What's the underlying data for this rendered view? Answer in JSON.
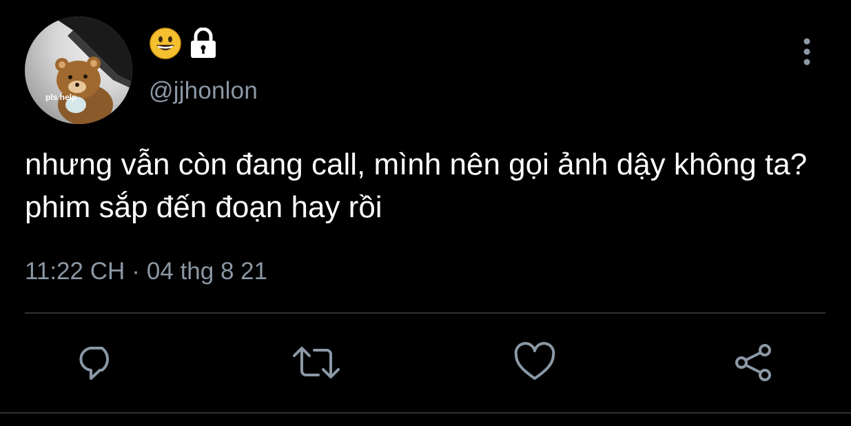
{
  "user": {
    "display_name_icons": [
      "grinning-face-emoji",
      "lock-icon"
    ],
    "handle": "@jjhonlon",
    "avatar_caption": "pls help"
  },
  "tweet": {
    "text": "nhưng vẫn còn đang call, mình nên gọi ảnh dậy không ta? phim sắp đến đoạn hay rồi",
    "time": "11:22 CH",
    "separator": "·",
    "date": "04 thg 8 21"
  },
  "actions": [
    "reply-icon",
    "retweet-icon",
    "like-icon",
    "share-icon"
  ],
  "colors": {
    "background": "#000000",
    "text": "#ffffff",
    "secondary": "#8b98a5",
    "divider": "#2f3336",
    "emoji": "#f5c030"
  }
}
